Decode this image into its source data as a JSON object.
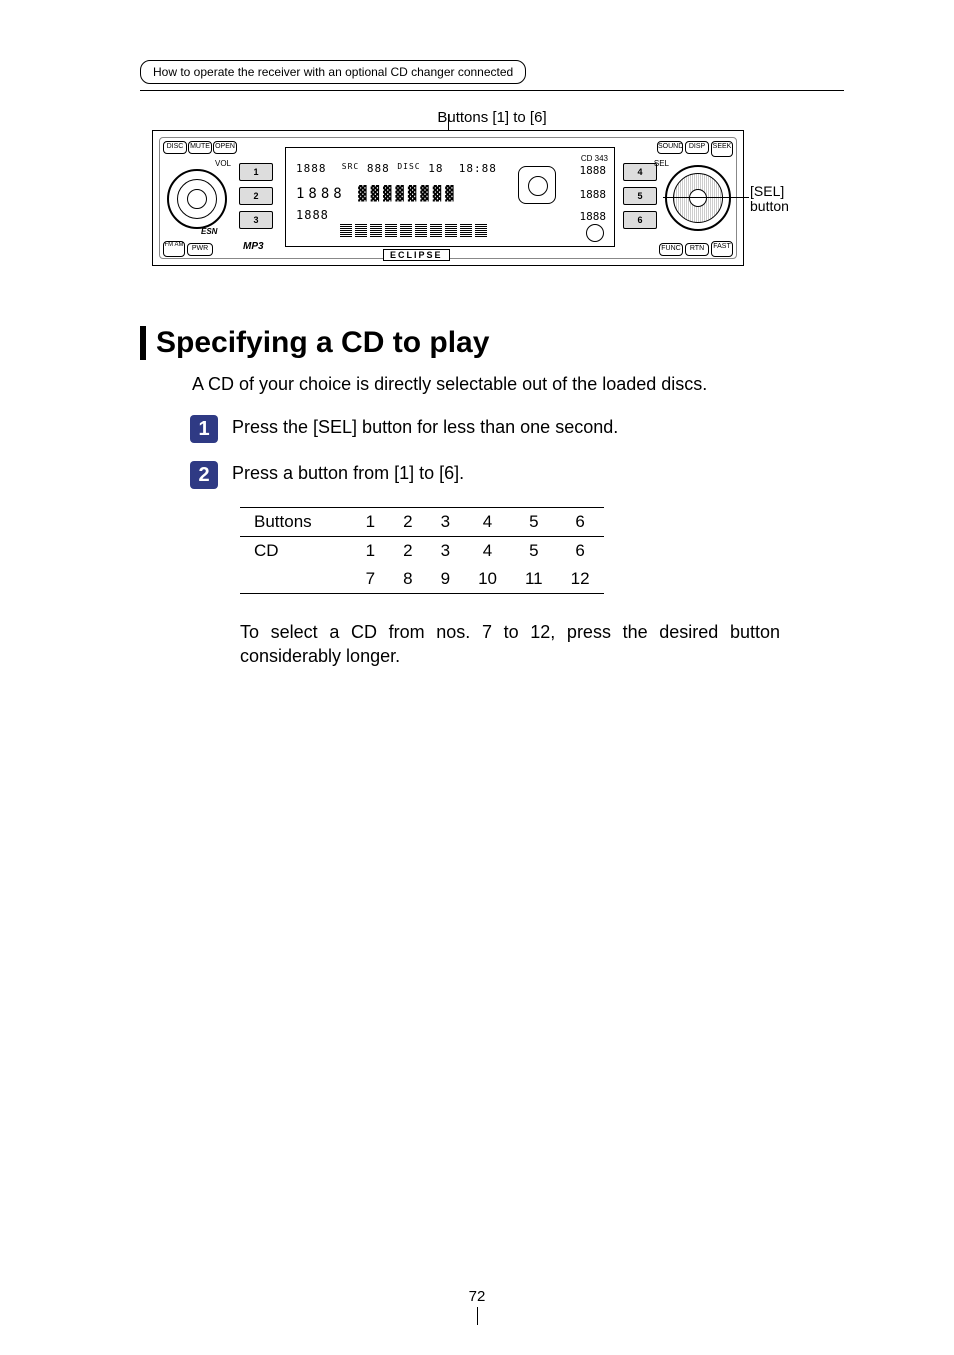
{
  "breadcrumb": "How to operate the receiver with an optional CD changer connected",
  "diagram": {
    "caption_top": "Buttons [1] to [6]",
    "callout_right_line1": "[SEL]",
    "callout_right_line2": "button",
    "model_label": "CD 343",
    "brand_label": "ECLIPSE",
    "mp3_label": "MP3",
    "vol_label": "VOL",
    "sel_label": "SEL",
    "esn_label": "ESN",
    "top_left_buttons": [
      "DISC",
      "MUTE",
      "OPEN"
    ],
    "bottom_left_buttons": [
      "FM AM",
      "PWR"
    ],
    "top_right_buttons": [
      "SOUND",
      "DISP",
      "SEEK"
    ],
    "bottom_right_buttons": [
      "FUNC",
      "RTN",
      "FAST"
    ],
    "left_preset_buttons": [
      "1",
      "2",
      "3"
    ],
    "right_preset_buttons": [
      "4",
      "5",
      "6"
    ],
    "display": {
      "row1_left": "1888",
      "row1_mid_small1": "SRC",
      "row1_mid": "888",
      "row1_mid_small2": "DISC",
      "row1_mid2": "18",
      "row1_time": "18:88",
      "row2_left": "1888",
      "row3_left": "1888",
      "side1": "1888",
      "side2": "1888",
      "side3": "1888"
    }
  },
  "section": {
    "heading": "Specifying a CD to play",
    "intro": "A CD of your choice is directly selectable out of the loaded discs.",
    "step1_num": "1",
    "step1_text": "Press the [SEL] button for less than one second.",
    "step2_num": "2",
    "step2_text": "Press a button from [1] to [6].",
    "table": {
      "header_label": "Buttons",
      "header_values": [
        "1",
        "2",
        "3",
        "4",
        "5",
        "6"
      ],
      "row2_label": "CD",
      "row2_values": [
        "1",
        "2",
        "3",
        "4",
        "5",
        "6"
      ],
      "row3_values": [
        "7",
        "8",
        "9",
        "10",
        "11",
        "12"
      ]
    },
    "note": "To select a CD from nos. 7 to 12, press the desired button considerably longer."
  },
  "page_number": "72"
}
